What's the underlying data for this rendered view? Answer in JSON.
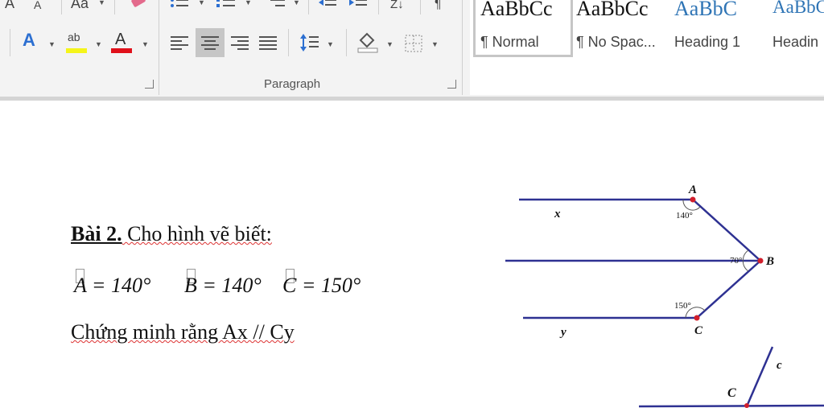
{
  "ribbon": {
    "font_group": {
      "grow_font": "A",
      "shrink_font": "A",
      "change_case": "Aa",
      "text_effects": "A",
      "highlight": "ab",
      "font_color": "A",
      "highlight_color": "#f5f51a",
      "font_color_value": "#e0101a"
    },
    "paragraph": {
      "label": "Paragraph",
      "sort": "Z↓",
      "show_marks": "¶"
    },
    "styles": [
      {
        "preview": "AaBbCc",
        "name": "¶ Normal"
      },
      {
        "preview": "AaBbCc",
        "name": "¶ No Spac..."
      },
      {
        "preview": "AaBbC",
        "name": "Heading 1"
      },
      {
        "preview": "AaBbC",
        "name": "Headin"
      }
    ]
  },
  "document": {
    "title_bold": "Bài 2.",
    "title_rest": " Cho hình vẽ biết:",
    "eq_a": "A = 140°",
    "eq_b": "B = 140°",
    "eq_c": "C = 150°",
    "prove": "Chứng minh rằng Ax // Cy",
    "figure": {
      "label_A": "A",
      "label_B": "B",
      "label_C": "C",
      "label_x": "x",
      "label_y": "y",
      "angle_A": "140°",
      "angle_B": "70°",
      "angle_C": "150°",
      "line_color": "#2e3192",
      "point_color": "#d21f2c"
    },
    "figure2": {
      "label_C": "C",
      "label_c": "c"
    }
  }
}
